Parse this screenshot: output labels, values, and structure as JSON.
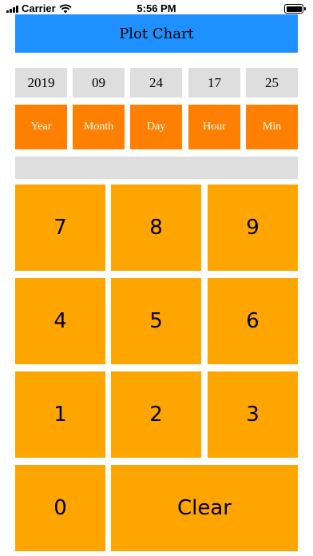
{
  "status_bar": {
    "carrier": "Carrier",
    "time": "5:56 PM",
    "icons": [
      "signal-icon",
      "wifi-icon",
      "battery-icon"
    ]
  },
  "plot_button": {
    "label": "Plot Chart"
  },
  "date_values": {
    "year": "2019",
    "month": "09",
    "day": "24",
    "hour": "17",
    "min": "25"
  },
  "unit_buttons": {
    "year": "Year",
    "month": "Month",
    "day": "Day",
    "hour": "Hour",
    "min": "Min"
  },
  "display": {
    "value": ""
  },
  "keypad": {
    "k7": "7",
    "k8": "8",
    "k9": "9",
    "k4": "4",
    "k5": "5",
    "k6": "6",
    "k1": "1",
    "k2": "2",
    "k3": "3",
    "k0": "0",
    "clear": "Clear"
  },
  "colors": {
    "plot_button": "#1e90ff",
    "unit_button": "#ff8000",
    "key": "#ffa500",
    "field": "#dedede"
  }
}
